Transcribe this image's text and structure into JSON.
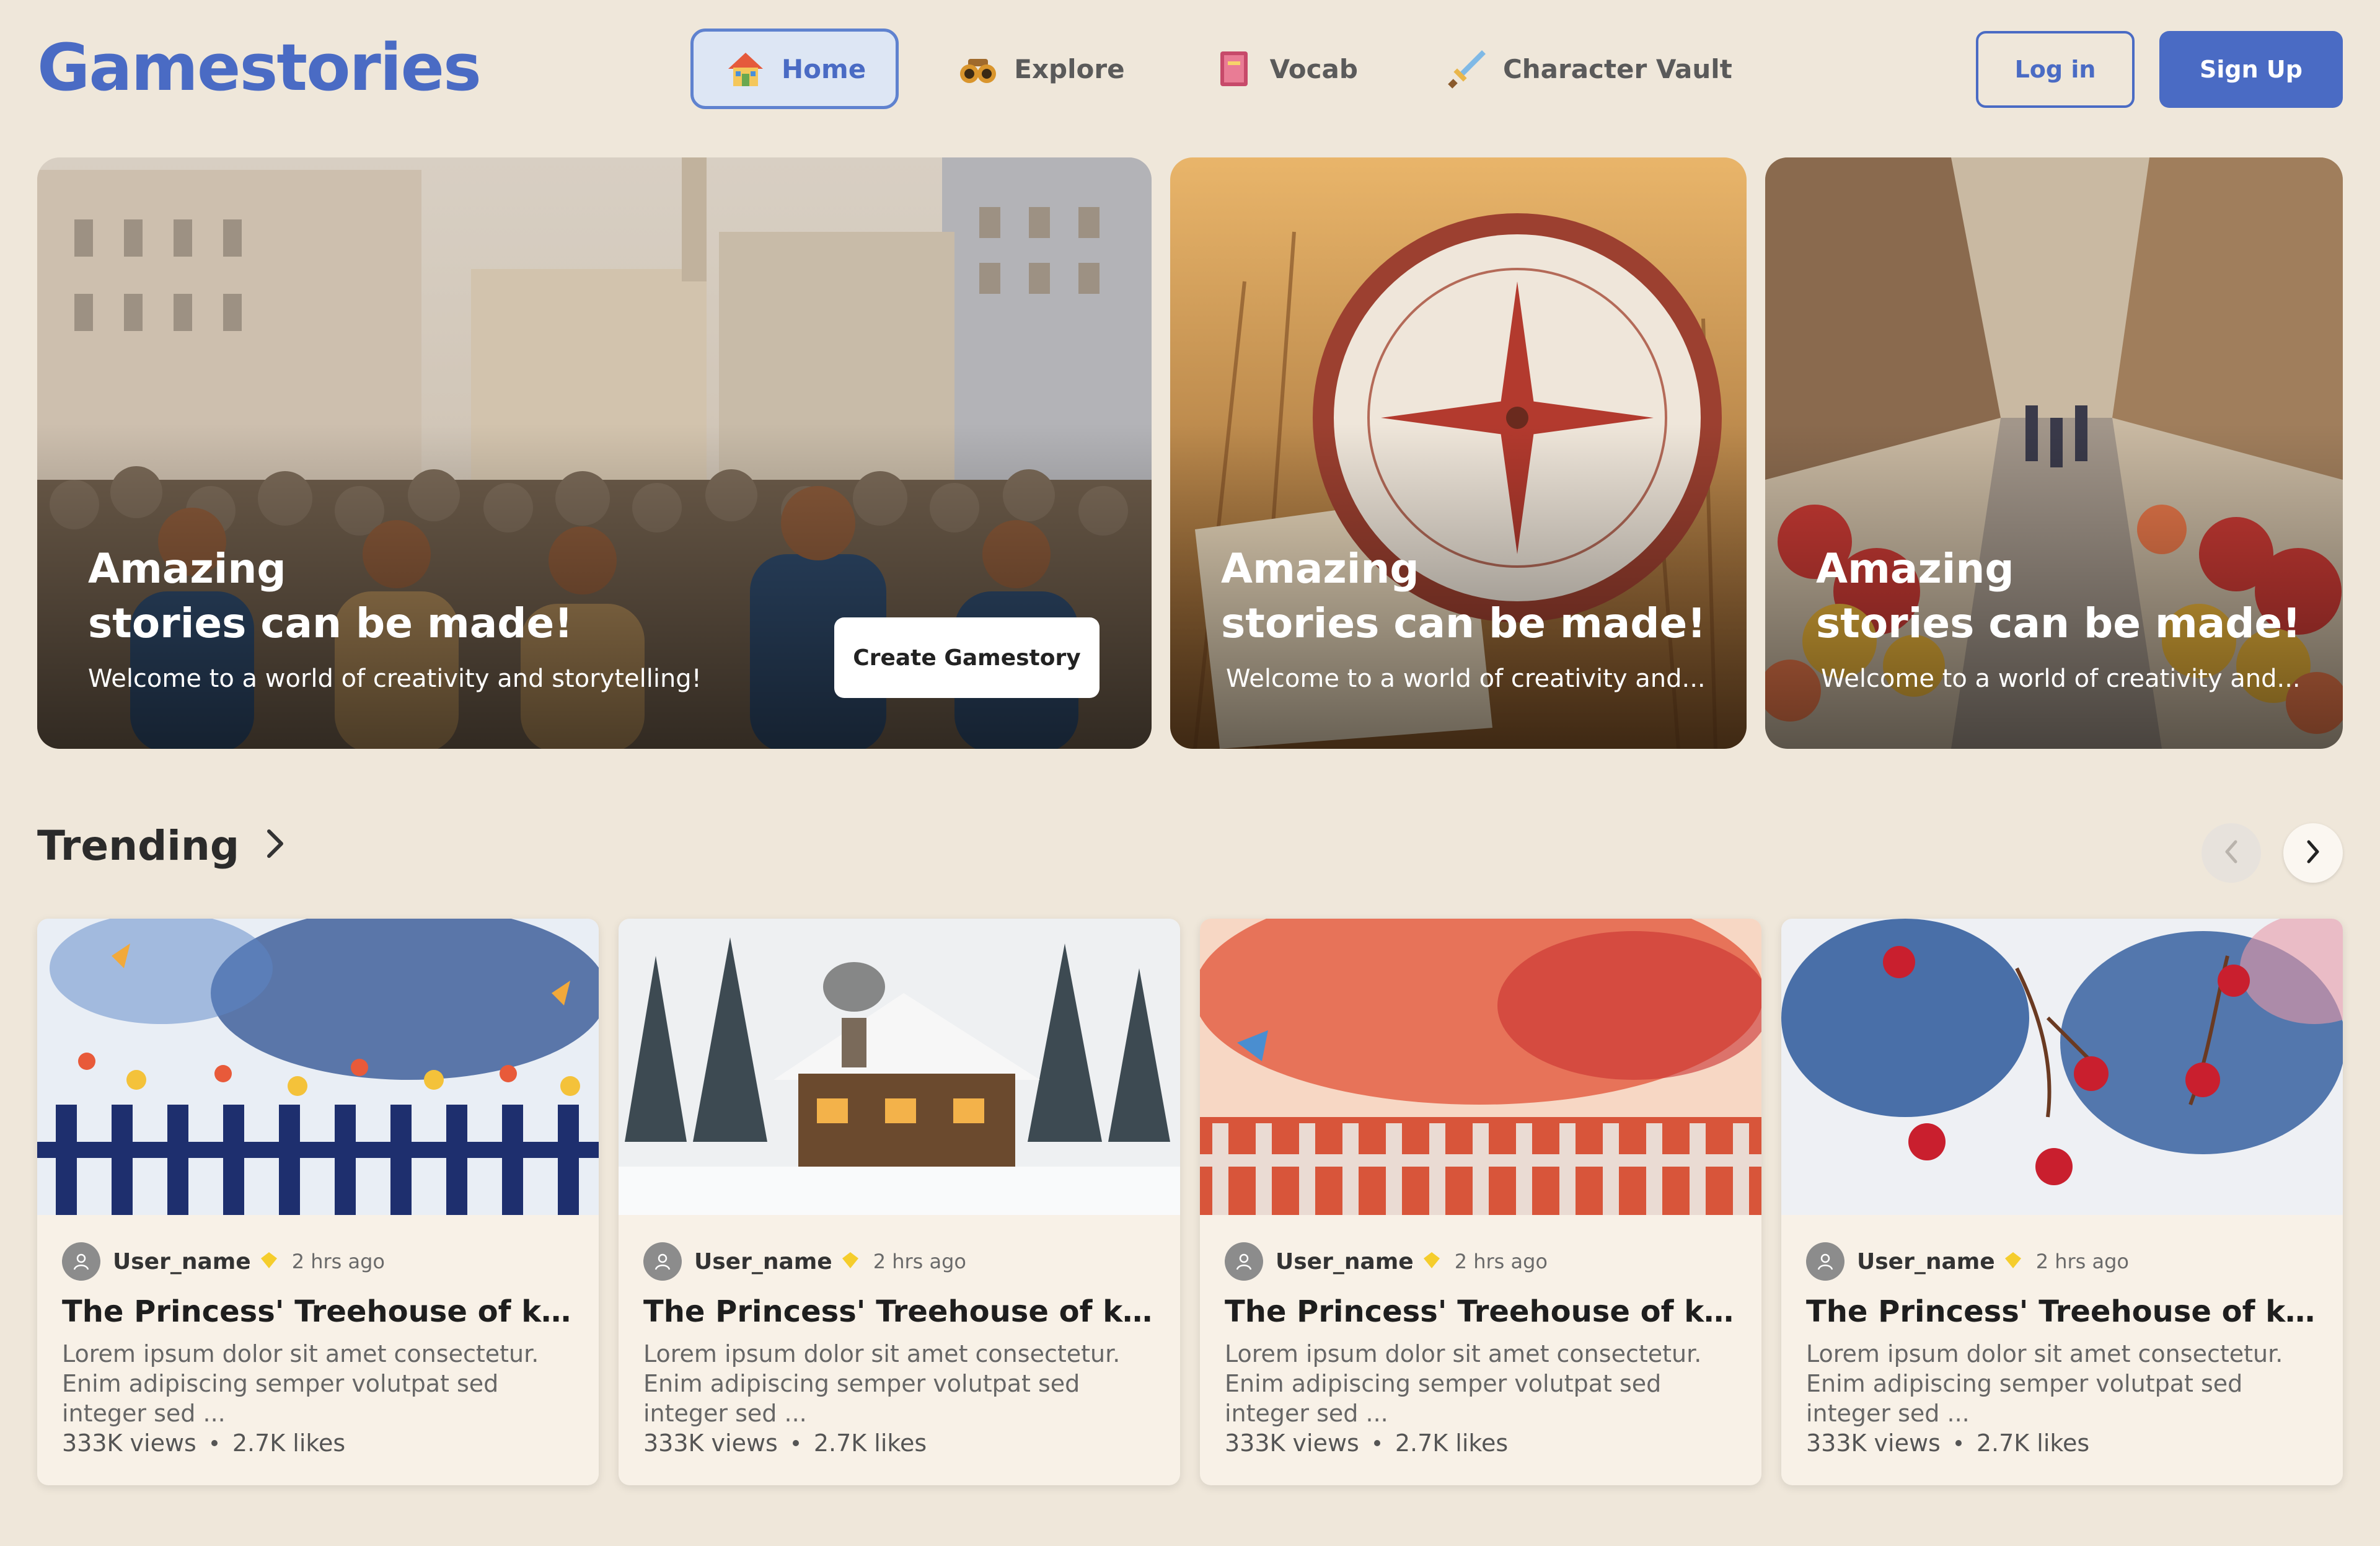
{
  "app": {
    "logo": "Gamestories"
  },
  "nav": {
    "items": [
      {
        "label": "Home",
        "icon": "house-icon",
        "active": true
      },
      {
        "label": "Explore",
        "icon": "binoculars-icon"
      },
      {
        "label": "Vocab",
        "icon": "book-icon"
      },
      {
        "label": "Character Vault",
        "icon": "sword-icon"
      }
    ]
  },
  "auth": {
    "login": "Log in",
    "signup": "Sign Up"
  },
  "hero": {
    "slides": [
      {
        "title_line1": "Amazing",
        "title_line2": "stories can be made!",
        "subtitle": "Welcome to a world of creativity and storytelling!",
        "cta": "Create Gamestory"
      },
      {
        "title_line1": "Amazing",
        "title_line2": "stories can be made!",
        "subtitle": "Welcome to a world of creativity and..."
      },
      {
        "title_line1": "Amazing",
        "title_line2": "stories can be made!",
        "subtitle": "Welcome to a world of creativity and..."
      }
    ]
  },
  "trending": {
    "title": "Trending",
    "cards": [
      {
        "user": "User_name",
        "time": "2 hrs ago",
        "title": "The Princess' Treehouse of king t ...",
        "desc": "Lorem ipsum dolor sit amet consectetur. Enim adipiscing semper volutpat sed integer sed ...",
        "views": "333K views",
        "likes": "2.7K likes"
      },
      {
        "user": "User_name",
        "time": "2 hrs ago",
        "title": "The Princess' Treehouse of king t ...",
        "desc": "Lorem ipsum dolor sit amet consectetur. Enim adipiscing semper volutpat sed integer sed ...",
        "views": "333K views",
        "likes": "2.7K likes"
      },
      {
        "user": "User_name",
        "time": "2 hrs ago",
        "title": "The Princess' Treehouse of king t ...",
        "desc": "Lorem ipsum dolor sit amet consectetur. Enim adipiscing semper volutpat sed integer sed ...",
        "views": "333K views",
        "likes": "2.7K likes"
      },
      {
        "user": "User_name",
        "time": "2 hrs ago",
        "title": "The Princess' Treehouse of king t ...",
        "desc": "Lorem ipsum dolor sit amet consectetur. Enim adipiscing semper volutpat sed integer sed ...",
        "views": "333K views",
        "likes": "2.7K likes"
      }
    ]
  },
  "colors": {
    "brand": "#4a6bc4",
    "background": "#efe7da",
    "card": "#f8f1e7"
  }
}
